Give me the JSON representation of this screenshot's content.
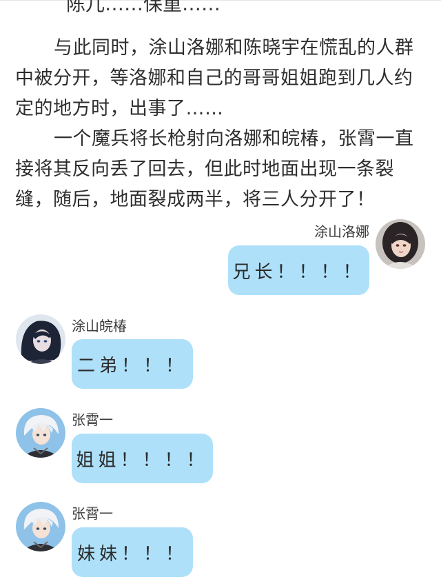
{
  "story": {
    "cut_line": "陈儿……保重……",
    "paragraph1": "与此同时，涂山洛娜和陈晓宇在慌乱的人群中被分开，等洛娜和自己的哥哥姐姐跑到几人约定的地方时，出事了……",
    "paragraph2": "一个魔兵将长枪射向洛娜和皖椿，张霄一直接将其反向丢了回去，但此时地面出现一条裂缝，随后，地面裂成两半，将三人分开了！"
  },
  "messages": [
    {
      "sender": "涂山洛娜",
      "text": "兄长！！！！",
      "side": "right",
      "avatar_icon": "girl-portrait-icon"
    },
    {
      "sender": "涂山皖椿",
      "text": "二弟！！！",
      "side": "left",
      "avatar_icon": "dark-hair-girl-icon"
    },
    {
      "sender": "张霄一",
      "text": "姐姐！！！！",
      "side": "left",
      "avatar_icon": "white-hair-boy-icon"
    },
    {
      "sender": "张霄一",
      "text": "妹妹！！！",
      "side": "left",
      "avatar_icon": "white-hair-boy-icon"
    }
  ],
  "colors": {
    "bubble": "#aee0f9",
    "text": "#2e2e2e"
  }
}
